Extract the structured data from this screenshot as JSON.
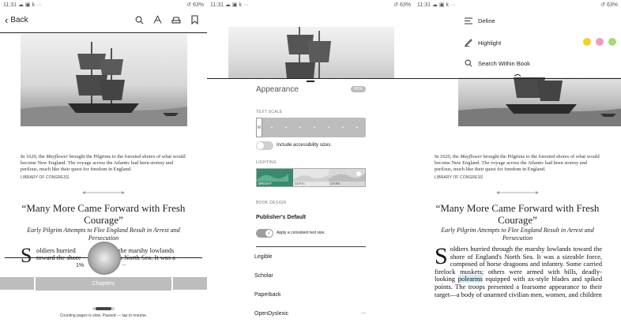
{
  "status": {
    "time": "11:31",
    "apps": "☁ ▣ k ···",
    "battery": "↺ 63%"
  },
  "reader": {
    "back_label": "Back",
    "caption_pre": "In 1620, the ",
    "caption_ital": "Mayflower",
    "caption_post": " brought the Pilgrims to the forested shores of what would become New England. The voyage across the Atlantic had been stormy and perilous, much like their quest for freedom in England.",
    "credit": "LIBRARY OF CONGRESS",
    "title": "“Many More Came Forward with Fresh Courage”",
    "subtitle": "Early Pilgrim Attempts to Flee England Result in Arrest and Persecution",
    "dropcap": "S",
    "body_visible": "oldiers hurried through the marshy lowlands toward the shore of England's North Sea. It was a sizeable force, composed of horse dragoons and infantry. Some carried firelock muskets; others were armed with bills, deadly-looking ",
    "highlight_word": "polearms",
    "body_after": " equipped with ax-style blades and spiked points. The troops presented a fearsome appearance to their target—a body of unarmed civilian men, women, and children"
  },
  "panel1": {
    "frag_left": "oldiers hurried",
    "frag_right": "the marshy lowlands",
    "frag_left2": "toward the shore",
    "frag_right2": "'s North Sea. It was a",
    "progress": "1%",
    "dots": "...",
    "chapters_label": "Chapters",
    "status_msg": "Counting pages is slow. Paused — tap to resume."
  },
  "appearance": {
    "title": "Appearance",
    "hide_label": "HIDE",
    "text_scale_label": "TEXT SCALE",
    "scale_value": "M",
    "accessibility_label": "Include accessibility sizes.",
    "lighting_label": "LIGHTING",
    "lighting": [
      "BRIGHT",
      "SEPIA",
      "DARK"
    ],
    "book_design_label": "BOOK DESIGN",
    "publishers_default": "Publisher's Default",
    "consistent_label": "Apply a consistent text size.",
    "fonts": [
      "Legible",
      "Scholar",
      "Paperback",
      "OpenDyslexic"
    ],
    "more": "..."
  },
  "menu": {
    "define": "Define",
    "highlight": "Highlight",
    "search": "Search Within Book",
    "colors": [
      "#f5d020",
      "#f49ac1",
      "#a7dc6b"
    ]
  },
  "colors": {
    "accent": "#3a8a6e",
    "gray_bar": "#bdbdbd",
    "highlight": "#d5ebf5"
  }
}
